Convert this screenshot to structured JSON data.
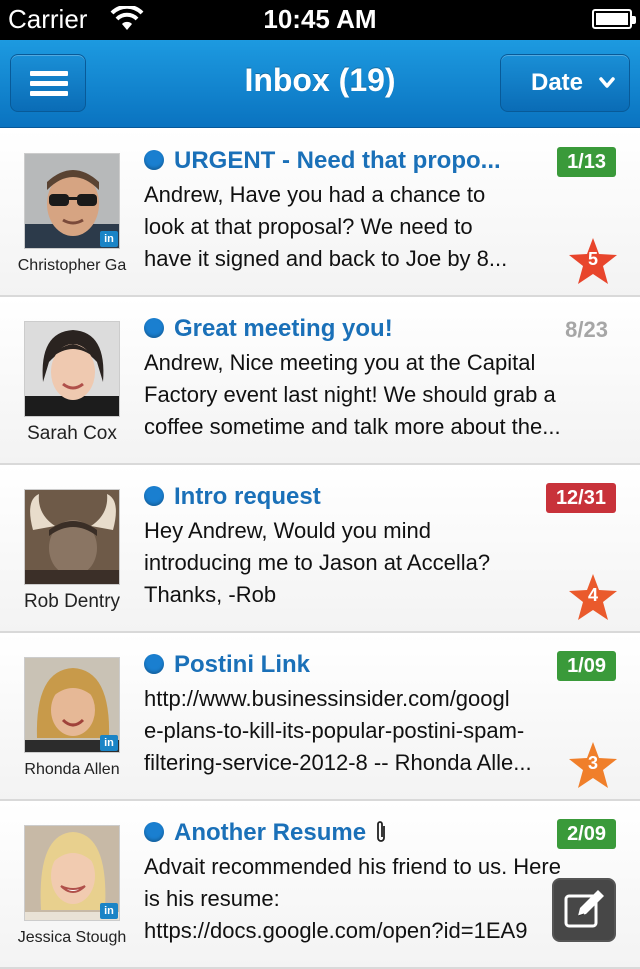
{
  "status_bar": {
    "carrier": "Carrier",
    "time": "10:45 AM"
  },
  "nav": {
    "title": "Inbox (19)",
    "sort_label": "Date"
  },
  "colors": {
    "nav_blue": "#0a7ccb",
    "subject_blue": "#1a70b8",
    "badge_green": "#3a9a3a",
    "badge_red": "#c8323a",
    "star_red": "#e8452c",
    "star_orange": "#f07f2a"
  },
  "messages": [
    {
      "sender": "Christopher Ga",
      "subject": "URGENT - Need that propo...",
      "preview": [
        "Andrew, Have you had a chance to",
        "look at that proposal? We need to",
        "have it signed and back to Joe by 8..."
      ],
      "date": "1/13",
      "date_style": "green",
      "star": "5"
    },
    {
      "sender": "Sarah Cox",
      "subject": "Great meeting you!",
      "preview": [
        "Andrew, Nice meeting you at the Capital",
        "Factory event last night! We should grab a",
        "coffee sometime and talk more about the..."
      ],
      "date": "8/23",
      "date_style": "plain"
    },
    {
      "sender": "Rob Dentry",
      "subject": "Intro request",
      "preview": [
        "Hey Andrew, Would you mind",
        "introducing me to Jason at Accella?",
        "Thanks, -Rob"
      ],
      "date": "12/31",
      "date_style": "red",
      "star": "4"
    },
    {
      "sender": "Rhonda Allen",
      "subject": "Postini Link",
      "preview": [
        "http://www.businessinsider.com/googl",
        "e-plans-to-kill-its-popular-postini-spam-",
        "filtering-service-2012-8 -- Rhonda Alle..."
      ],
      "date": "1/09",
      "date_style": "green",
      "star": "3"
    },
    {
      "sender": "Jessica Stough",
      "subject": "Another Resume",
      "preview": [
        "Advait recommended his friend to us. Here",
        "is his resume:",
        "https://docs.google.com/open?id=1EA9"
      ],
      "date": "2/09",
      "date_style": "green"
    }
  ],
  "linkedin_badge": "in"
}
